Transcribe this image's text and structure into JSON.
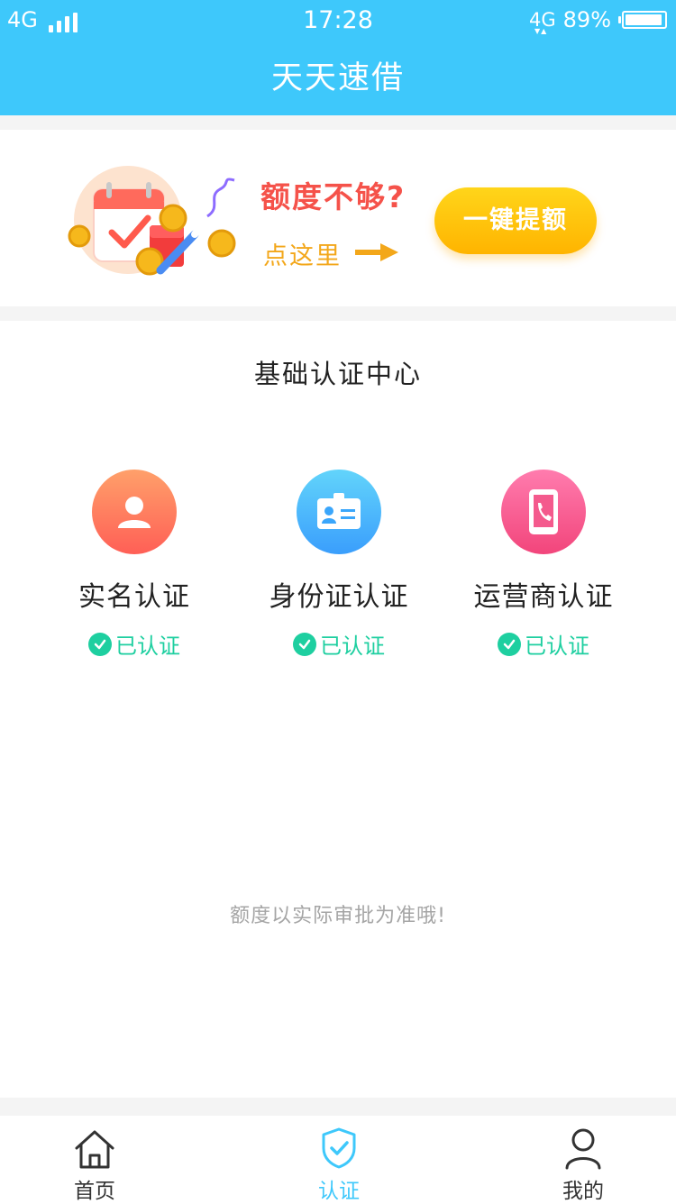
{
  "status_bar": {
    "network_left": "4G",
    "time": "17:28",
    "network_right": "4G",
    "battery": "89%",
    "battery_level": 0.89
  },
  "header": {
    "title": "天天速借"
  },
  "banner": {
    "question": "额度不够?",
    "click_here": "点这里",
    "button_label": "一键提额"
  },
  "verification": {
    "title": "基础认证中心",
    "items": [
      {
        "label": "实名认证",
        "status": "已认证",
        "icon": "person-icon"
      },
      {
        "label": "身份证认证",
        "status": "已认证",
        "icon": "id-card-icon"
      },
      {
        "label": "运营商认证",
        "status": "已认证",
        "icon": "phone-icon"
      }
    ],
    "note": "额度以实际审批为准哦!"
  },
  "tabbar": {
    "active": "认证",
    "items": [
      {
        "label": "首页",
        "icon": "home-icon"
      },
      {
        "label": "认证",
        "icon": "shield-check-icon"
      },
      {
        "label": "我的",
        "icon": "user-icon"
      }
    ]
  },
  "colors": {
    "header_bg": "#3ec8fb",
    "verified_green": "#1ecfa0",
    "question_red": "#f5524a",
    "button_yellow": "#ffc20e"
  }
}
